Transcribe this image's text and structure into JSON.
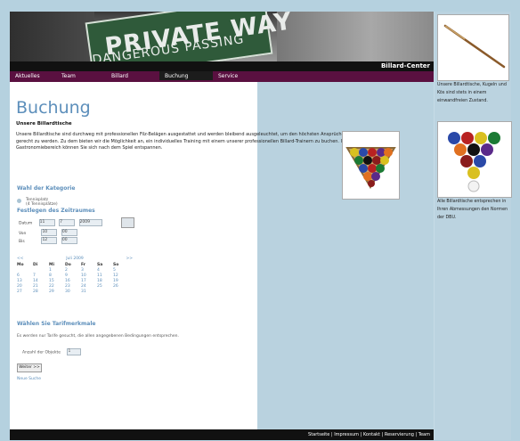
{
  "header": {
    "sign_line1": "PRIVATE WAY",
    "sign_line2": "DANGEROUS PASSING",
    "brand": "Billard-Center"
  },
  "nav": {
    "items": [
      "Aktuelles",
      "Team",
      "Billard",
      "Buchung",
      "Service"
    ],
    "active": "Buchung"
  },
  "main": {
    "title": "Buchung",
    "subtitle": "Unsere Billardtische",
    "intro": "Unsere Billardtische sind durchweg mit professionellen Filz-Belägen ausgestattet und werden bleibend ausgeleuchtet, um den höchsten Ansprüchen gerecht zu werden. Zu dem bieten wir die Möglichkeit an, ein individuelles Training mit einem unserer professionellen Billard-Trainern zu buchen. Im Gastronomiebereich können Sie sich nach dem Spiel entspannen."
  },
  "kategorie": {
    "heading": "Wahl der Kategorie",
    "option_name": "Tennisplatz",
    "option_sub": "(4 Tennisplätze)"
  },
  "zeitraum": {
    "heading": "Festlegen des Zeitraumes",
    "datum_label": "Datum",
    "day": "11",
    "month": "7",
    "year": "2009",
    "von_label": "Von",
    "von_h": "10",
    "von_m": "00",
    "bis_label": "Bis",
    "bis_h": "12",
    "bis_m": "00"
  },
  "calendar": {
    "prev": "<<",
    "next": ">>",
    "month_label": "Juli 2009",
    "day_headers": [
      "Mo",
      "Di",
      "Mi",
      "Do",
      "Fr",
      "Sa",
      "So"
    ],
    "days": [
      "",
      "",
      "1",
      "2",
      "3",
      "4",
      "5",
      "6",
      "7",
      "8",
      "9",
      "10",
      "11",
      "12",
      "13",
      "14",
      "15",
      "16",
      "17",
      "18",
      "19",
      "20",
      "21",
      "22",
      "23",
      "24",
      "25",
      "26",
      "27",
      "28",
      "29",
      "30",
      "31",
      "",
      ""
    ]
  },
  "tarif": {
    "heading": "Wählen Sie Tarifmerkmale",
    "text": "Es werden nur Tarife gesucht, die allen angegebenen Bedingungen entsprechen.",
    "anzahl_label": "Anzahl der Objekte",
    "anzahl_value": "1",
    "weiter_label": "Weiter >>",
    "neue_suche": "Neue Suche"
  },
  "footer": {
    "text": "Startseite | Impressum | Kontakt | Reservierung | Team"
  },
  "sidebar": {
    "text1": "Unsere Billardtische, Kugeln und Kös sind stets in einem einwandfreien Zustand.",
    "text2": "Alle Billardtische entsprechen in Ihren Abmessungen den Normen der DBU."
  }
}
